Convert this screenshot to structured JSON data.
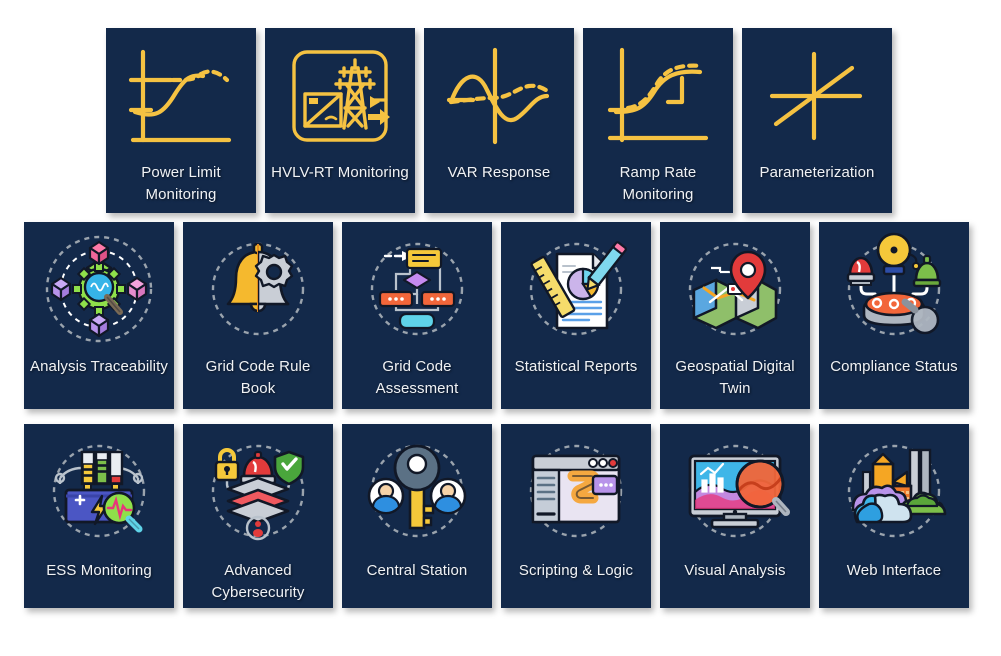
{
  "palette": {
    "background": "#ffffff",
    "card_background": "#13294a",
    "label_color": "#f0f2f5",
    "row1_icon_gold": "#F5C242",
    "dashed_circle": "#9aa3ad"
  },
  "rows": [
    {
      "name": "monitoring-row",
      "cards": [
        {
          "id": "power-limit-monitoring",
          "label": "Power Limit Monitoring",
          "icon": "power-limit-chart-icon",
          "icon_style": "gold-line"
        },
        {
          "id": "hvlv-rt-monitoring",
          "label": "HVLV-RT Monitoring",
          "icon": "transmission-tower-icon",
          "icon_style": "gold-line"
        },
        {
          "id": "var-response",
          "label": "VAR Response",
          "icon": "sine-wave-icon",
          "icon_style": "gold-line"
        },
        {
          "id": "ramp-rate-monitoring",
          "label": "Ramp Rate Monitoring",
          "icon": "ramp-curve-icon",
          "icon_style": "gold-line"
        },
        {
          "id": "parameterization",
          "label": "Parameterization",
          "icon": "axes-slope-icon",
          "icon_style": "gold-line"
        }
      ]
    },
    {
      "name": "analysis-row",
      "cards": [
        {
          "id": "analysis-traceability",
          "label": "Analysis Traceability",
          "icon": "atom-magnifier-icon",
          "icon_style": "color-flat"
        },
        {
          "id": "grid-code-rule-book",
          "label": "Grid Code Rule Book",
          "icon": "bell-gear-icon",
          "icon_style": "color-flat"
        },
        {
          "id": "grid-code-assessment",
          "label": "Grid Code Assessment",
          "icon": "flowchart-icon",
          "icon_style": "color-flat"
        },
        {
          "id": "statistical-reports",
          "label": "Statistical Reports",
          "icon": "report-document-icon",
          "icon_style": "color-flat"
        },
        {
          "id": "geospatial-digital-twin",
          "label": "Geospatial Digital Twin",
          "icon": "map-pin-icon",
          "icon_style": "color-flat"
        },
        {
          "id": "compliance-status",
          "label": "Compliance Status",
          "icon": "alarm-lights-icon",
          "icon_style": "color-flat"
        }
      ]
    },
    {
      "name": "platform-row",
      "cards": [
        {
          "id": "ess-monitoring",
          "label": "ESS Monitoring",
          "icon": "battery-monitor-icon",
          "icon_style": "color-flat"
        },
        {
          "id": "advanced-cybersecurity",
          "label": "Advanced Cybersecurity",
          "icon": "lock-shield-layers-icon",
          "icon_style": "color-flat"
        },
        {
          "id": "central-station",
          "label": "Central Station",
          "icon": "key-users-icon",
          "icon_style": "color-flat"
        },
        {
          "id": "scripting-logic",
          "label": "Scripting & Logic",
          "icon": "code-window-icon",
          "icon_style": "color-flat"
        },
        {
          "id": "visual-analysis",
          "label": "Visual Analysis",
          "icon": "monitor-chart-magnifier-icon",
          "icon_style": "color-flat"
        },
        {
          "id": "web-interface",
          "label": "Web Interface",
          "icon": "cloud-factory-icon",
          "icon_style": "color-flat"
        }
      ]
    }
  ]
}
